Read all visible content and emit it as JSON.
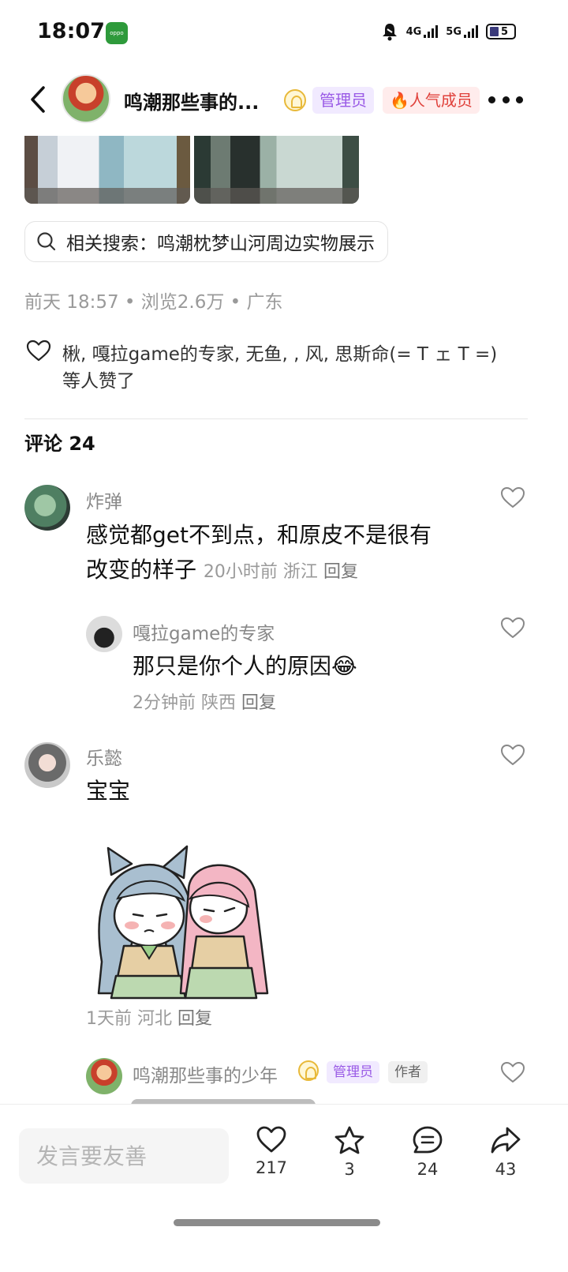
{
  "status_bar": {
    "time": "18:07",
    "app_icon": "oppo-app-icon",
    "app_icon_label": "oppo",
    "network1": "4G",
    "network2": "5G",
    "battery": "5"
  },
  "header": {
    "title": "鸣潮那些事的...",
    "admin_tag": "管理员",
    "popular_tag": "人气成员"
  },
  "related_search": {
    "text": "相关搜索：鸣潮枕梦山河周边实物展示"
  },
  "post_meta": "前天 18:57 • 浏览2.6万 • 广东",
  "likes": {
    "text": "楸, 嘎拉game的专家, 无鱼, , 风, 思斯命(= T ェ T =)",
    "suffix": "等人赞了"
  },
  "comments_title": "评论 24",
  "comments": [
    {
      "name": "炸弹",
      "text_line1": "感觉都get不到点，和原皮不是很有",
      "text_line2": "改变的样子",
      "time": "20小时前",
      "location": "浙江",
      "reply": "回复"
    },
    {
      "name": "嘎拉game的专家",
      "text": "那只是你个人的原因😂",
      "time": "2分钟前",
      "location": "陕西",
      "reply": "回复"
    },
    {
      "name": "乐懿",
      "text": "宝宝",
      "time": "1天前",
      "location": "河北",
      "reply": "回复"
    },
    {
      "name": "鸣潮那些事的少年",
      "admin_tag": "管理员",
      "author_tag": "作者"
    }
  ],
  "bottom_bar": {
    "input_placeholder": "发言要友善",
    "like_count": "217",
    "favorite_count": "3",
    "comment_count": "24",
    "share_count": "43"
  }
}
